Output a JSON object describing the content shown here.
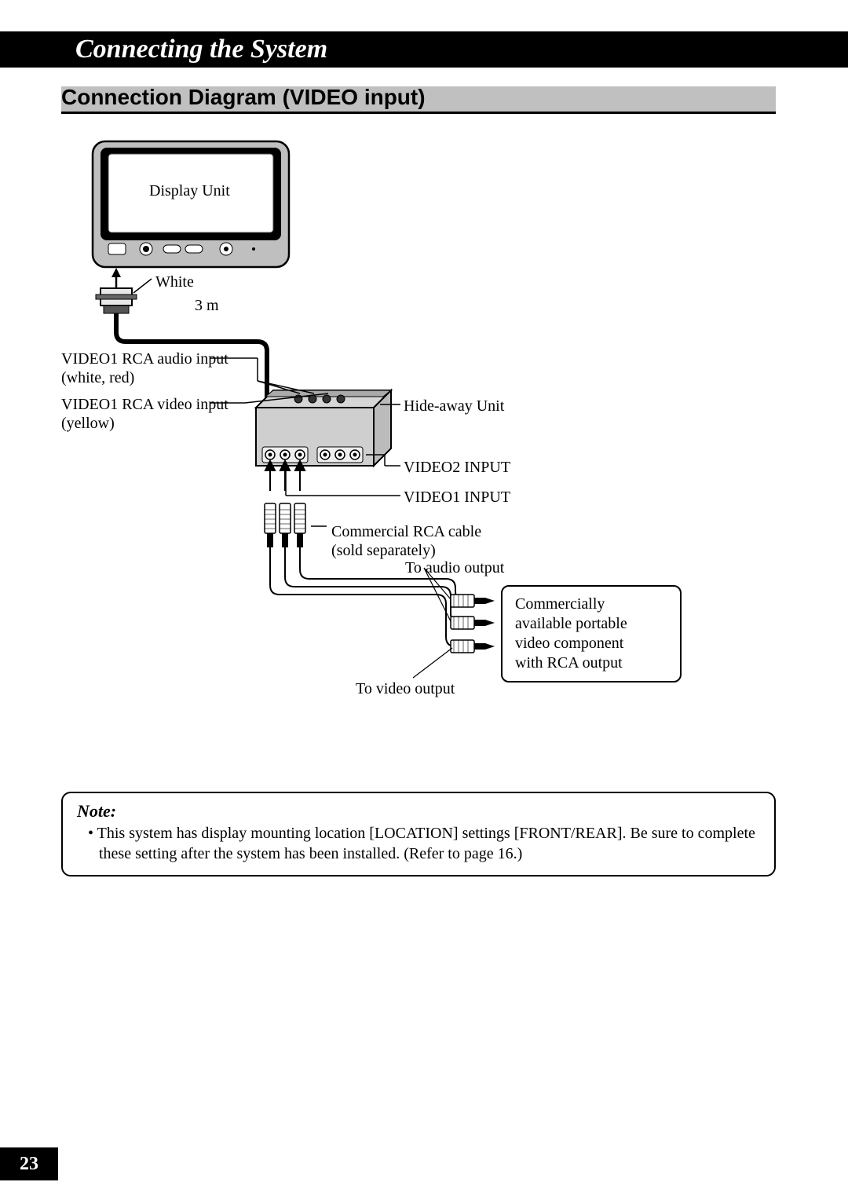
{
  "chapter_title": "Connecting the System",
  "section_title": "Connection Diagram (VIDEO input)",
  "page_number": "23",
  "labels": {
    "display_unit": "Display Unit",
    "white": "White",
    "length": "3 m",
    "video1_audio_a": "VIDEO1 RCA audio input",
    "video1_audio_b": "(white, red)",
    "video1_video_a": "VIDEO1 RCA video input",
    "video1_video_b": "(yellow)",
    "hideaway": "Hide-away Unit",
    "video2_input": "VIDEO2 INPUT",
    "video1_input": "VIDEO1 INPUT",
    "rca_cable_a": "Commercial RCA cable",
    "rca_cable_b": "(sold separately)",
    "to_audio": "To audio output",
    "to_video": "To video output",
    "device_a": "Commercially",
    "device_b": "available portable",
    "device_c": "video component",
    "device_d": "with RCA output"
  },
  "note": {
    "heading": "Note:",
    "body": "•  This system has display mounting location [LOCATION] settings [FRONT/REAR]. Be sure to complete these setting after the system has been installed. (Refer to page 16.)"
  }
}
